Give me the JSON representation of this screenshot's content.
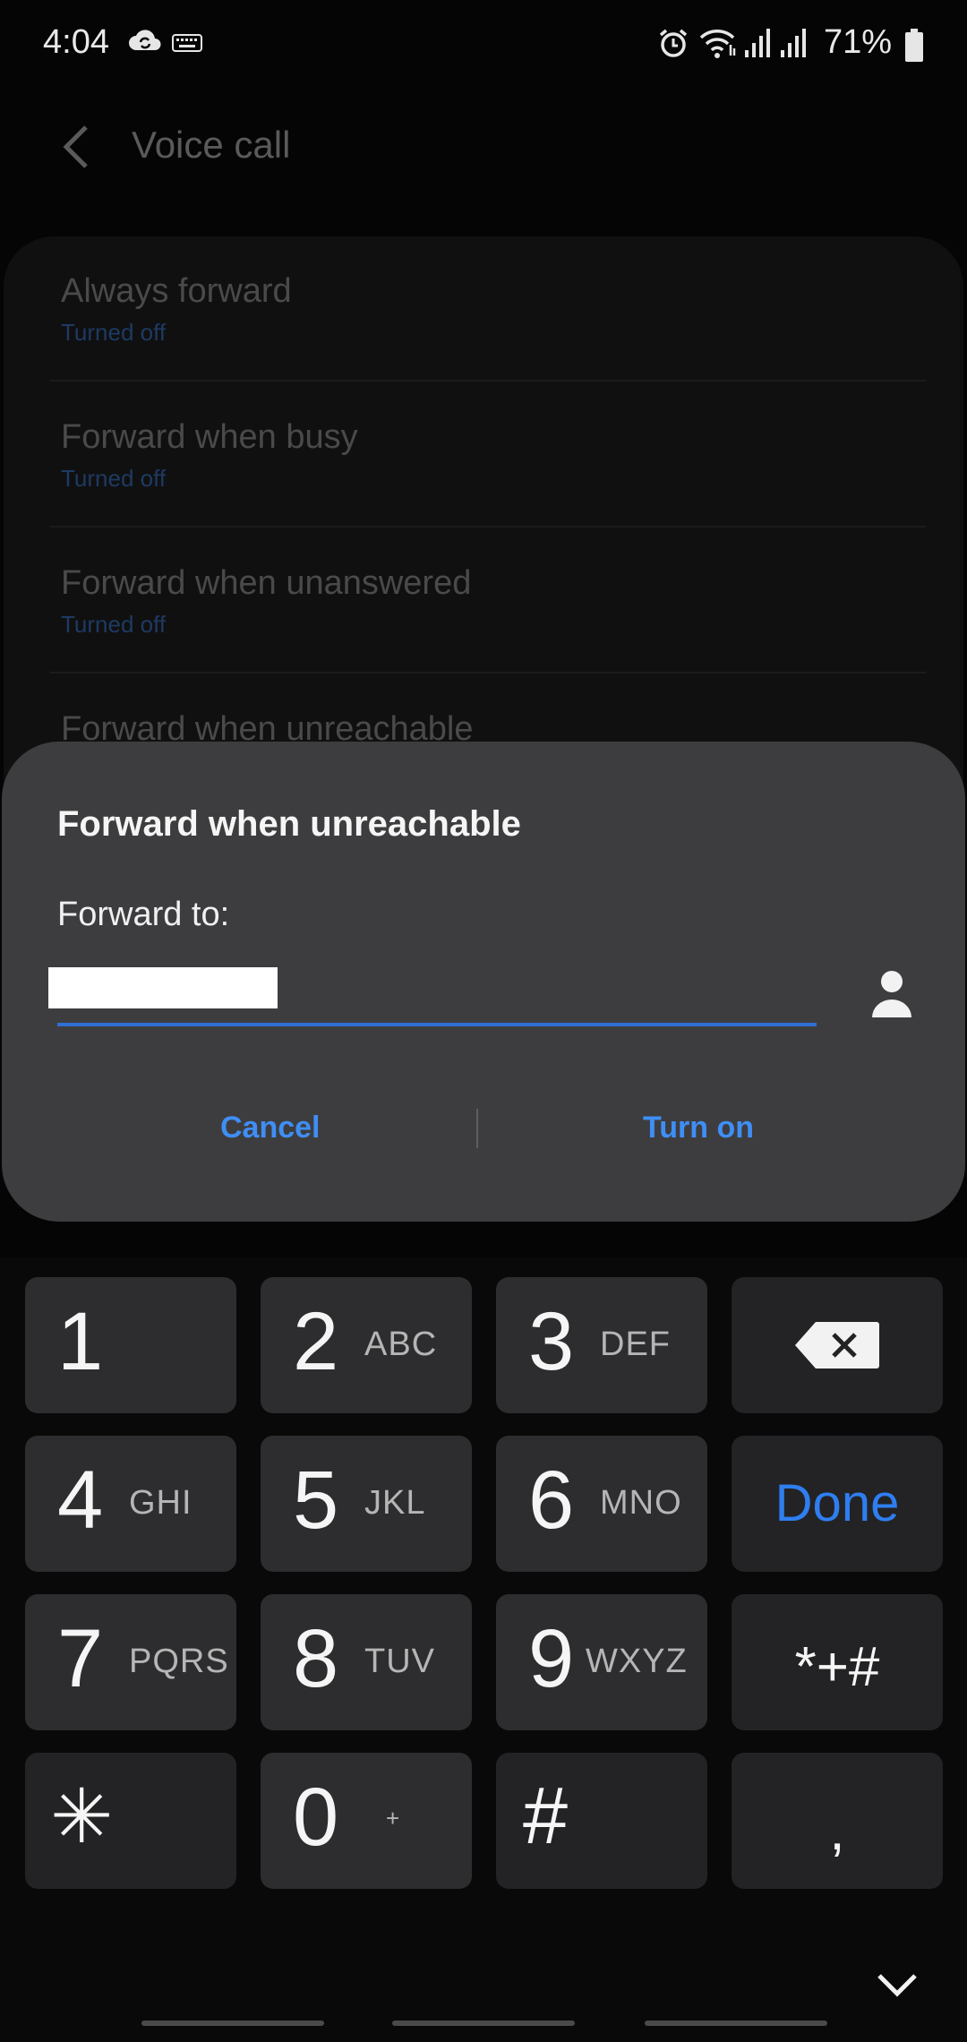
{
  "status_bar": {
    "time": "4:04",
    "battery": "71%",
    "icons": [
      "cloud-sync-icon",
      "keyboard-icon",
      "alarm-icon",
      "wifi-icon",
      "signal-icon",
      "signal-icon",
      "battery-icon"
    ]
  },
  "app_bar": {
    "title": "Voice call"
  },
  "settings": [
    {
      "title": "Always forward",
      "status": "Turned off"
    },
    {
      "title": "Forward when busy",
      "status": "Turned off"
    },
    {
      "title": "Forward when unanswered",
      "status": "Turned off"
    },
    {
      "title": "Forward when unreachable",
      "status": ""
    }
  ],
  "dialog": {
    "title": "Forward when unreachable",
    "label": "Forward to:",
    "input_value": "",
    "cancel": "Cancel",
    "confirm": "Turn on",
    "accent": "#3f8ef5"
  },
  "keypad": {
    "keys": [
      {
        "num": "1",
        "letters": ""
      },
      {
        "num": "2",
        "letters": "ABC"
      },
      {
        "num": "3",
        "letters": "DEF"
      },
      {
        "num": "4",
        "letters": "GHI"
      },
      {
        "num": "5",
        "letters": "JKL"
      },
      {
        "num": "6",
        "letters": "MNO"
      },
      {
        "num": "7",
        "letters": "PQRS"
      },
      {
        "num": "8",
        "letters": "TUV"
      },
      {
        "num": "9",
        "letters": "WXYZ"
      },
      {
        "num": "0",
        "letters": "+"
      }
    ],
    "done": "Done",
    "symbols": "*+#",
    "star": "✳",
    "hash": "#",
    "comma": ","
  }
}
